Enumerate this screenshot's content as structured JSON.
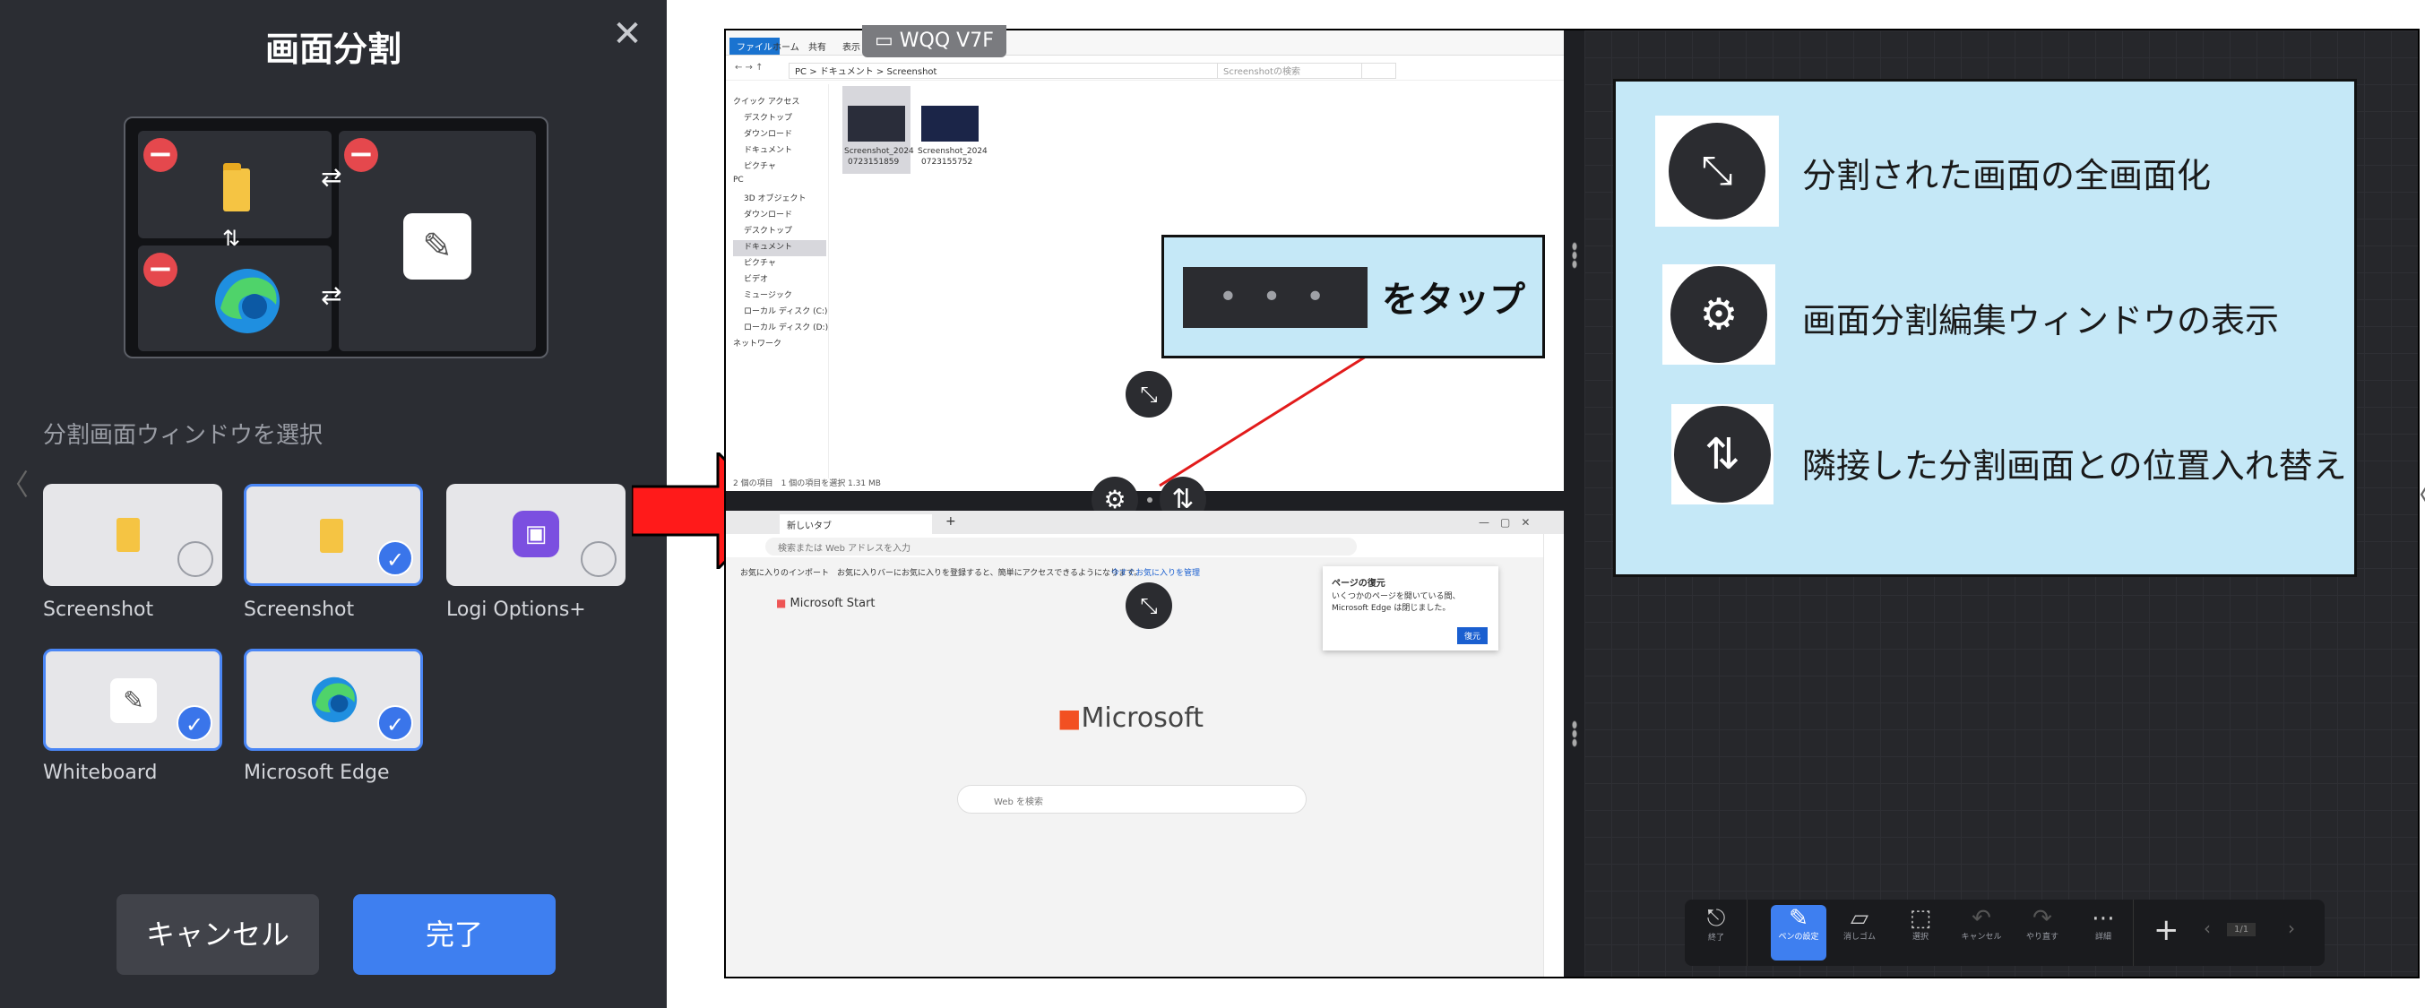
{
  "panel": {
    "title": "画面分割",
    "close_icon": "close-icon",
    "select_label": "分割画面ウィンドウを選択",
    "cards": [
      {
        "label": "Screenshot",
        "icon": "folder-icon",
        "selected": false
      },
      {
        "label": "Screenshot",
        "icon": "folder-icon",
        "selected": true
      },
      {
        "label": "Logi Options+",
        "icon": "logi-options-icon",
        "selected": false
      },
      {
        "label": "Whiteboard",
        "icon": "whiteboard-pen-icon",
        "selected": true
      },
      {
        "label": "Microsoft Edge",
        "icon": "edge-icon",
        "selected": true
      }
    ],
    "cancel_label": "キャンセル",
    "done_label": "完了"
  },
  "screen": {
    "window_label": "WQQ V7F",
    "explorer": {
      "tabs": [
        "ファイル",
        "ホーム",
        "共有",
        "表示"
      ],
      "path": "PC > ドキュメント > Screenshot",
      "search_placeholder": "Screenshotの検索",
      "nav": [
        "クイック アクセス",
        "デスクトップ",
        "ダウンロード",
        "ドキュメント",
        "ピクチャ",
        "PC",
        "3D オブジェクト",
        "ダウンロード",
        "デスクトップ",
        "ドキュメント",
        "ピクチャ",
        "ビデオ",
        "ミュージック",
        "ローカル ディスク (C:)",
        "ローカル ディスク (D:)",
        "ネットワーク"
      ],
      "files": [
        {
          "name1": "Screenshot_2024",
          "name2": "0723151859"
        },
        {
          "name1": "Screenshot_2024",
          "name2": "0723155752"
        }
      ],
      "status": "2 個の項目",
      "status2": "1 個の項目を選択 1.31 MB"
    },
    "edge": {
      "tab": "新しいタブ",
      "address_placeholder": "検索または Web アドレスを入力",
      "favbar1": "お気に入りのインポート",
      "favbar2": "お気に入りバーにお気に入りを登録すると、簡単にアクセスできるようになります。",
      "favbar_link": "今すぐお気に入りを管理",
      "ms_start": "Microsoft Start",
      "ms_logo": "Microsoft",
      "search_placeholder": "Web を検索",
      "restore_title": "ページの復元",
      "restore_text": "いくつかのページを開いている間、Microsoft Edge は閉じました。",
      "restore_button": "復元"
    },
    "callout_text": "をタップ",
    "callout_dots": "• • •",
    "legend": [
      {
        "icon": "fullscreen-icon",
        "text": "分割された画面の全画面化"
      },
      {
        "icon": "settings-icon",
        "text": "画面分割編集ウィンドウの表示"
      },
      {
        "icon": "swap-vertical-icon",
        "text": "隣接した分割画面との位置入れ替え"
      }
    ],
    "toolbar": [
      {
        "icon": "exit-icon",
        "label": "終了"
      },
      {
        "icon": "pen-icon",
        "label": "ペンの設定"
      },
      {
        "icon": "eraser-icon",
        "label": "消しゴム"
      },
      {
        "icon": "select-icon",
        "label": "選択"
      },
      {
        "icon": "undo-icon",
        "label": "キャンセル"
      },
      {
        "icon": "redo-icon",
        "label": "やり直す"
      },
      {
        "icon": "more-icon",
        "label": "詳細"
      }
    ],
    "page_indicator": "1/1",
    "colors": {
      "accent": "#3e7ff0",
      "callout_bg": "#c5e8f7",
      "arrow": "#ff1a1a"
    }
  }
}
